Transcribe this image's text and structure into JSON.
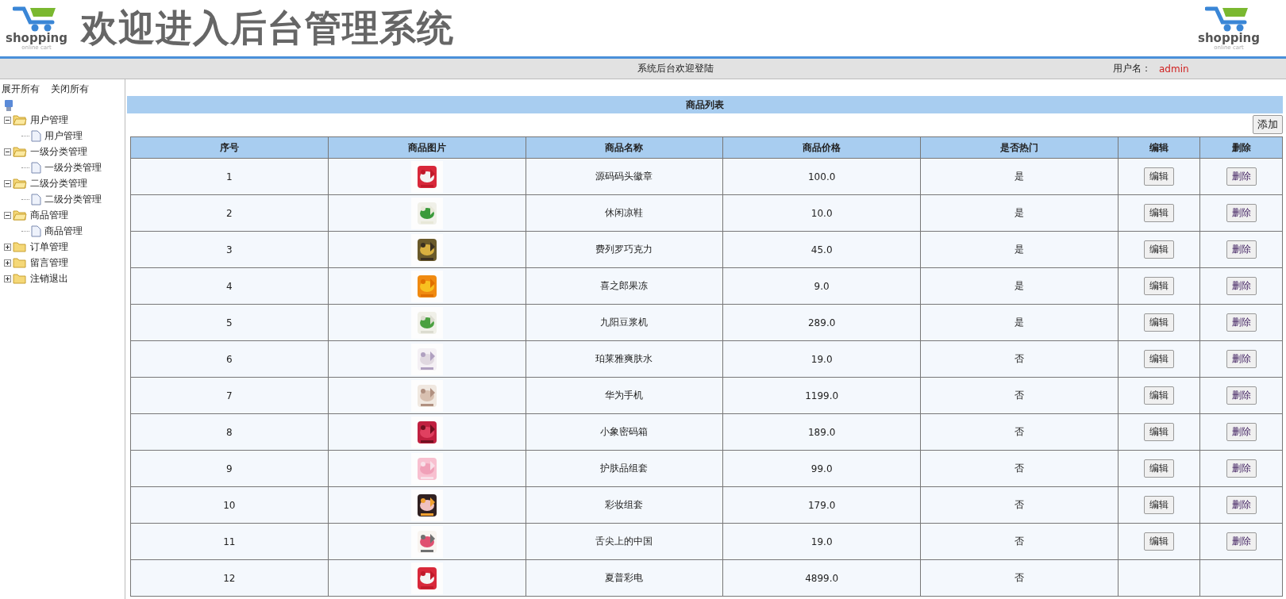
{
  "header": {
    "logo_text": "shopping",
    "logo_subtext": "online cart",
    "title": "欢迎进入后台管理系统",
    "right_logo_text": "shopping",
    "right_logo_subtext": "online cart"
  },
  "top_bar": {
    "welcome": "系统后台欢迎登陆",
    "user_label": "用户名：",
    "username": "admin"
  },
  "sidebar": {
    "expand_all": "展开所有",
    "collapse_all": "关闭所有",
    "tree": [
      {
        "label": "用户管理",
        "expanded": true,
        "children": [
          {
            "label": "用户管理"
          }
        ]
      },
      {
        "label": "一级分类管理",
        "expanded": true,
        "children": [
          {
            "label": "一级分类管理"
          }
        ]
      },
      {
        "label": "二级分类管理",
        "expanded": true,
        "children": [
          {
            "label": "二级分类管理"
          }
        ]
      },
      {
        "label": "商品管理",
        "expanded": true,
        "children": [
          {
            "label": "商品管理"
          }
        ]
      },
      {
        "label": "订单管理",
        "expanded": false
      },
      {
        "label": "留言管理",
        "expanded": false
      },
      {
        "label": "注销退出",
        "expanded": false
      }
    ]
  },
  "panel": {
    "title": "商品列表",
    "add_button": "添加"
  },
  "table": {
    "columns": [
      "序号",
      "商品图片",
      "商品名称",
      "商品价格",
      "是否热门",
      "编辑",
      "删除"
    ],
    "rows": [
      {
        "index": "1",
        "name": "源码码头徽章",
        "price": "100.0",
        "hot": "是",
        "edit": "编辑",
        "delete": "删除"
      },
      {
        "index": "2",
        "name": "休闲凉鞋",
        "price": "10.0",
        "hot": "是",
        "edit": "编辑",
        "delete": "删除"
      },
      {
        "index": "3",
        "name": "费列罗巧克力",
        "price": "45.0",
        "hot": "是",
        "edit": "编辑",
        "delete": "删除"
      },
      {
        "index": "4",
        "name": "喜之郎果冻",
        "price": "9.0",
        "hot": "是",
        "edit": "编辑",
        "delete": "删除"
      },
      {
        "index": "5",
        "name": "九阳豆浆机",
        "price": "289.0",
        "hot": "是",
        "edit": "编辑",
        "delete": "删除"
      },
      {
        "index": "6",
        "name": "珀莱雅爽肤水",
        "price": "19.0",
        "hot": "否",
        "edit": "编辑",
        "delete": "删除"
      },
      {
        "index": "7",
        "name": "华为手机",
        "price": "1199.0",
        "hot": "否",
        "edit": "编辑",
        "delete": "删除"
      },
      {
        "index": "8",
        "name": "小象密码箱",
        "price": "189.0",
        "hot": "否",
        "edit": "编辑",
        "delete": "删除"
      },
      {
        "index": "9",
        "name": "护肤品组套",
        "price": "99.0",
        "hot": "否",
        "edit": "编辑",
        "delete": "删除"
      },
      {
        "index": "10",
        "name": "彩妆组套",
        "price": "179.0",
        "hot": "否",
        "edit": "编辑",
        "delete": "删除"
      },
      {
        "index": "11",
        "name": "舌尖上的中国",
        "price": "19.0",
        "hot": "否",
        "edit": "编辑",
        "delete": "删除"
      },
      {
        "index": "12",
        "name": "夏普彩电",
        "price": "4899.0",
        "hot": "否"
      }
    ]
  }
}
